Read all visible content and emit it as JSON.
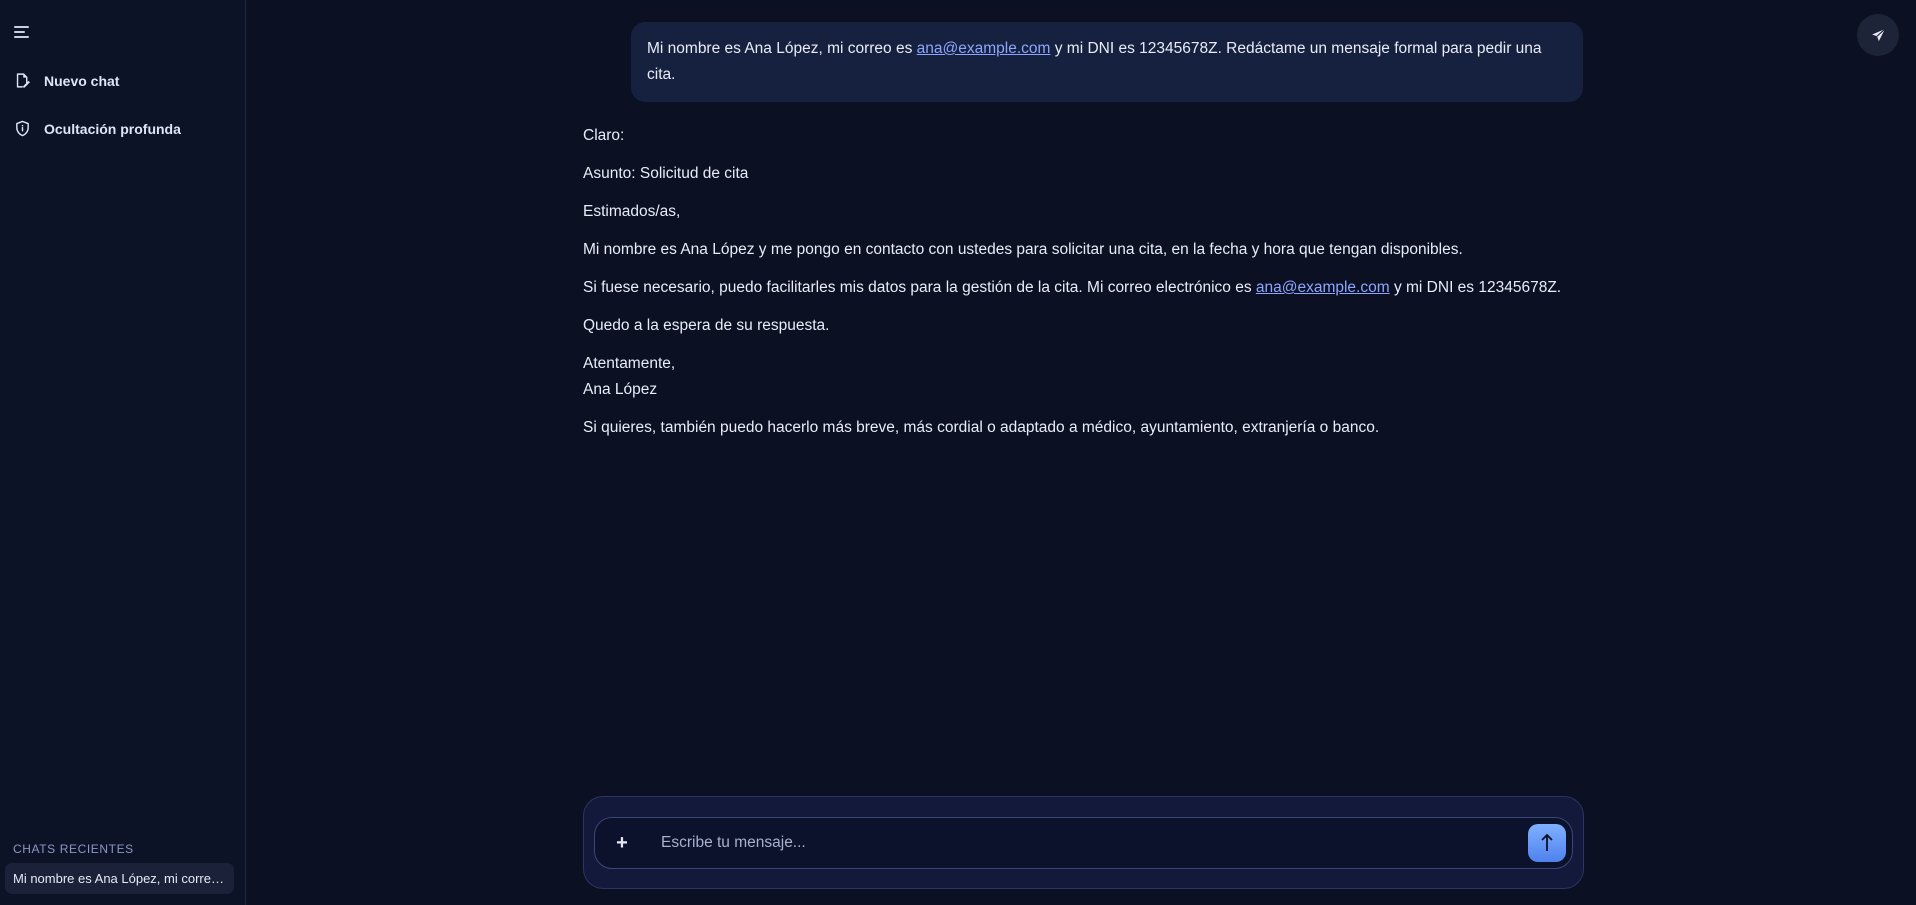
{
  "sidebar": {
    "nav": {
      "new_chat": "Nuevo chat",
      "deep_hide": "Ocultación profunda"
    },
    "recent_title": "CHATS RECIENTES",
    "recent_items": [
      {
        "label": "Mi nombre es Ana López, mi correo es ana@example.com y mi DNI es 12345678Z."
      }
    ]
  },
  "user_message": {
    "before_email": "Mi nombre es Ana López, mi correo es ",
    "email": "ana@example.com",
    "after_email": " y mi DNI es 12345678Z. Redáctame un mensaje formal para pedir una cita."
  },
  "assistant_message": {
    "intro": "Claro:",
    "subject": "Asunto: Solicitud de cita",
    "greeting": "Estimados/as,",
    "body1": "Mi nombre es Ana López y me pongo en contacto con ustedes para solicitar una cita, en la fecha y hora que tengan disponibles.",
    "body2_before": "Si fuese necesario, puedo facilitarles mis datos para la gestión de la cita. Mi correo electrónico es ",
    "body2_email": "ana@example.com",
    "body2_after": " y mi DNI es 12345678Z.",
    "body3": "Quedo a la espera de su respuesta.",
    "closing": "Atentamente,",
    "signature": "Ana López",
    "followup": "Si quieres, también puedo hacerlo más breve, más cordial o adaptado a médico, ayuntamiento, extranjería o banco."
  },
  "composer": {
    "plus": "+",
    "placeholder": "Escribe tu mensaje..."
  },
  "colors": {
    "background": "#0b1022",
    "sidebar": "#0d1327",
    "user_bubble": "#16213f",
    "link": "#8ca6ff",
    "send_button": "#5f94f6"
  },
  "icons": {
    "menu": "menu-icon",
    "new_chat": "edit-icon",
    "deep_hide": "shield-icon",
    "top_send": "paper-plane-icon",
    "send": "arrow-up-icon"
  }
}
